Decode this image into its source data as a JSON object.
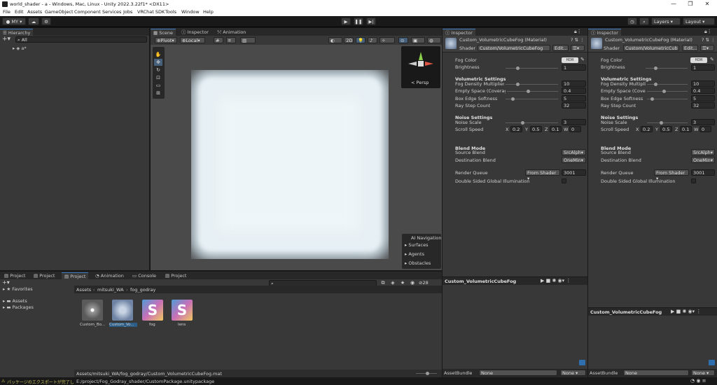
{
  "window": {
    "title": "world_shader - a - Windows, Mac, Linux - Unity 2022.3.22f1* <DX11>",
    "min": "—",
    "max": "❐",
    "close": "✕"
  },
  "menu": [
    "File",
    "Edit",
    "Assets",
    "GameObject",
    "Component",
    "Services",
    "Jobs",
    "VRChat SDK",
    "Tools",
    "Window",
    "Help"
  ],
  "toolbar": {
    "account": "MY",
    "layers": "Layers",
    "layout": "Layout"
  },
  "hierarchy": {
    "tab": "Hierarchy",
    "search": "All",
    "scene": "a*"
  },
  "scene": {
    "tabs": [
      "Scene",
      "Inspector",
      "Animation"
    ],
    "pivot": "Pivot",
    "space": "Local",
    "mode2d": "2D",
    "persp": "< Persp",
    "overlay": {
      "title": "AI Navigation",
      "items": [
        "Surfaces",
        "Agents",
        "Obstacles"
      ]
    }
  },
  "project": {
    "tabs": [
      "Project",
      "Project",
      "Project",
      "Animation",
      "Console",
      "Project"
    ],
    "favorites": "Favorites",
    "tree": [
      "Assets",
      "Packages"
    ],
    "breadcrumb": [
      "Assets",
      "mitsuki_WA",
      "fog_godray"
    ],
    "count": "28",
    "assets": [
      {
        "name": "Custom_Bo..."
      },
      {
        "name": "Custom_Vo..."
      },
      {
        "name": "fog"
      },
      {
        "name": "lens"
      }
    ],
    "path": "Assets/mitsuki_WA/fog_godray/Custom_VolumetricCubeFog.mat"
  },
  "inspector1": {
    "tab": "Inspector",
    "title": "Custom_VolumetricCubeFog (Material)",
    "shader_label": "Shader",
    "shader": "Custom/VolumetricCubeFog",
    "edit": "Edit...",
    "fog_color": "Fog Color",
    "hdr": "HDR",
    "brightness": "Brightness",
    "brightness_val": "1",
    "vol_header": "Volumetric Settings",
    "density_label": "Fog Density Multiplier",
    "density": "10",
    "empty_label": "Empty Space (Coverage",
    "empty": "0.4",
    "edge_label": "Box Edge Softness",
    "edge": "5",
    "ray_label": "Ray Step Count",
    "ray": "32",
    "noise_header": "Noise Settings",
    "noise_scale_label": "Noise Scale",
    "noise_scale": "3",
    "scroll_label": "Scroll Speed",
    "sx": "0.2",
    "sy": "0.5",
    "sz": "0.1",
    "sw": "0",
    "blend_header": "Blend Mode",
    "src_label": "Source Blend",
    "src": "SrcAlph",
    "dst_label": "Destination Blend",
    "dst": "OneMin",
    "rq_label": "Render Queue",
    "rq_mode": "From Shader",
    "rq": "3001",
    "dsgi": "Double Sided Global Illumination",
    "preview_title": "Custom_VolumetricCubeFog",
    "assetbundle": "AssetBundle",
    "ab1": "None",
    "ab2": "None"
  },
  "inspector2": {
    "tab": "Inspector",
    "title": "Custom_VolumetricCubeFog (Material)",
    "shader_label": "Shader",
    "shader": "Custom/VolumetricCub",
    "edit": "Edit...",
    "fog_color": "Fog Color",
    "hdr": "HDR",
    "brightness": "Brightness",
    "brightness_val": "1",
    "vol_header": "Volumetric Settings",
    "density_label": "Fog Density Multiplie",
    "density": "10",
    "empty_label": "Empty Space (Cover",
    "empty": "0.4",
    "edge_label": "Box Edge Softness",
    "edge": "5",
    "ray_label": "Ray Step Count",
    "ray": "32",
    "noise_header": "Noise Settings",
    "noise_scale_label": "Noise Scale",
    "noise_scale": "3",
    "scroll_label": "Scroll Speed",
    "sx": "0.2",
    "sy": "0.5",
    "sz": "0.1",
    "sw": "0",
    "blend_header": "Blend Mode",
    "src_label": "Source Blend",
    "src": "SrcAlph",
    "dst_label": "Destination Blend",
    "dst": "OneMin",
    "rq_label": "Render Queue",
    "rq_mode": "From Shader",
    "rq": "3001",
    "dsgi": "Double Sided Global Illumination",
    "preview_title": "Custom_VolumetricCubeFog",
    "assetbundle": "AssetBundle",
    "ab1": "None",
    "ab2": "None"
  },
  "status": {
    "warn": "パッケージのエクスポートが完了しました。",
    "path": "E:/project/Fog_Godray_shader/CustomPackage.unitypackage"
  },
  "colors": {
    "accent": "#3a79bb",
    "fog": "#e6eef2",
    "bg": "#383838"
  }
}
